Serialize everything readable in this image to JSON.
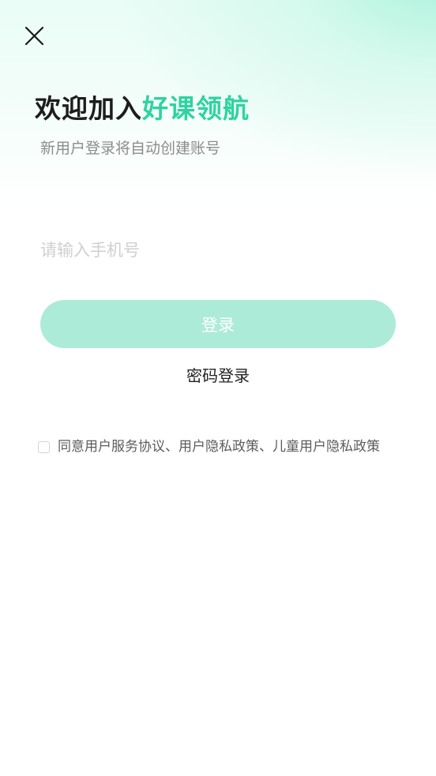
{
  "header": {
    "close_icon": "close-icon"
  },
  "welcome": {
    "title_prefix": "欢迎加入",
    "title_brand": "好课领航",
    "subtitle": "新用户登录将自动创建账号"
  },
  "phone": {
    "placeholder": "请输入手机号",
    "value": ""
  },
  "login": {
    "button_label": "登录",
    "password_login_label": "密码登录"
  },
  "agreement": {
    "checked": false,
    "text": "同意用户服务协议、用户隐私政策、儿童用户隐私政策"
  },
  "colors": {
    "brand": "#2fd39f",
    "button_disabled": "#acebd8",
    "title": "#1d1d1d",
    "subtitle": "#8c8c8c"
  }
}
